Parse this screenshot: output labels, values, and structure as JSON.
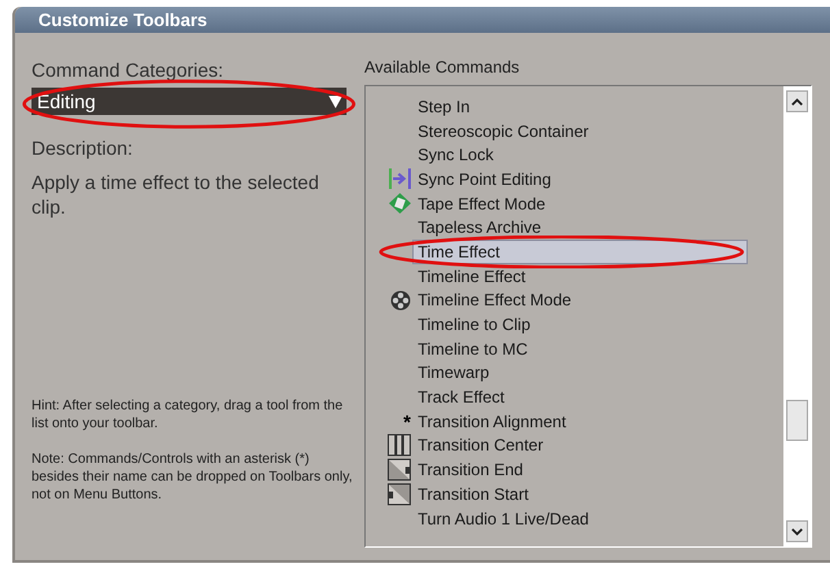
{
  "window": {
    "title": "Customize Toolbars"
  },
  "categories": {
    "label": "Command Categories:",
    "value": "Editing",
    "circled": true
  },
  "description": {
    "label": "Description:",
    "text": "Apply a time effect to the selected clip."
  },
  "hint": "Hint: After selecting a category, drag a tool from the list onto your toolbar.",
  "note": "Note: Commands/Controls with an asterisk (*) besides their name can be dropped on Toolbars only, not on Menu Buttons.",
  "commands": {
    "label": "Available Commands",
    "items": [
      {
        "label": "Step In",
        "kind": "plain",
        "selected": false,
        "circled": false
      },
      {
        "label": "Stereoscopic Container",
        "kind": "plain",
        "selected": false,
        "circled": false
      },
      {
        "label": "Sync Lock",
        "kind": "plain",
        "selected": false,
        "circled": false
      },
      {
        "label": "Sync Point Editing",
        "kind": "sync",
        "selected": false,
        "circled": false
      },
      {
        "label": "Tape Effect Mode",
        "kind": "tape",
        "selected": false,
        "circled": false
      },
      {
        "label": "Tapeless Archive",
        "kind": "plain",
        "selected": false,
        "circled": false
      },
      {
        "label": "Time Effect",
        "kind": "plain",
        "selected": true,
        "circled": true
      },
      {
        "label": "Timeline Effect",
        "kind": "plain",
        "selected": false,
        "circled": false
      },
      {
        "label": "Timeline Effect Mode",
        "kind": "reel",
        "selected": false,
        "circled": false
      },
      {
        "label": "Timeline to Clip",
        "kind": "plain",
        "selected": false,
        "circled": false
      },
      {
        "label": "Timeline to MC",
        "kind": "plain",
        "selected": false,
        "circled": false
      },
      {
        "label": "Timewarp",
        "kind": "plain",
        "selected": false,
        "circled": false
      },
      {
        "label": "Track Effect",
        "kind": "plain",
        "selected": false,
        "circled": false
      },
      {
        "label": "Transition Alignment",
        "kind": "asterisk",
        "mark": "*",
        "selected": false,
        "circled": false
      },
      {
        "label": "Transition Center",
        "kind": "center",
        "selected": false,
        "circled": false
      },
      {
        "label": "Transition End",
        "kind": "end",
        "selected": false,
        "circled": false
      },
      {
        "label": "Transition Start",
        "kind": "start",
        "selected": false,
        "circled": false
      },
      {
        "label": "Turn Audio 1 Live/Dead",
        "kind": "plain",
        "selected": false,
        "circled": false
      }
    ]
  }
}
